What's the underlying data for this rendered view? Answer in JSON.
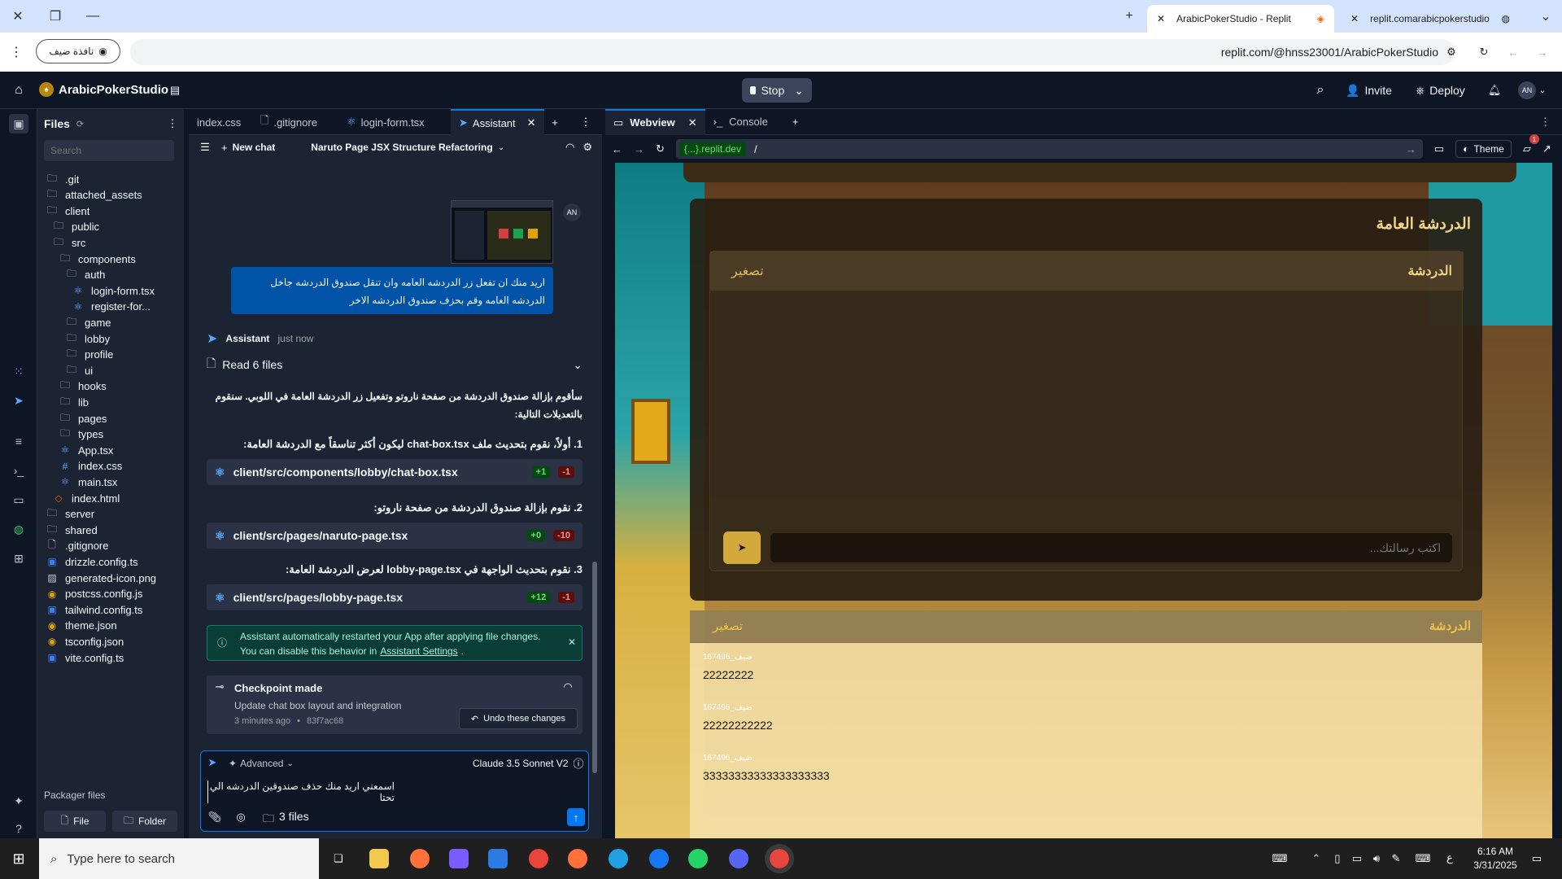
{
  "browser": {
    "tabs": [
      {
        "title": "ArabicPokerStudio - Replit",
        "active": true
      },
      {
        "title": "replit.comarabicpokerstudio",
        "active": false
      }
    ],
    "guest_label": "نافذة ضيف",
    "url": "replit.com/@hnss23001/ArabicPokerStudio"
  },
  "replit": {
    "project_name": "ArabicPokerStudio",
    "stop_label": "Stop",
    "invite_label": "Invite",
    "deploy_label": "Deploy",
    "avatar": "AN"
  },
  "files": {
    "title": "Files",
    "search_placeholder": "Search",
    "tree": [
      {
        "name": ".git",
        "type": "folder",
        "depth": 0
      },
      {
        "name": "attached_assets",
        "type": "folder",
        "depth": 0
      },
      {
        "name": "client",
        "type": "folder",
        "depth": 0
      },
      {
        "name": "public",
        "type": "folder",
        "depth": 1
      },
      {
        "name": "src",
        "type": "folder",
        "depth": 1
      },
      {
        "name": "components",
        "type": "folder",
        "depth": 2
      },
      {
        "name": "auth",
        "type": "folder",
        "depth": 3
      },
      {
        "name": "login-form.tsx",
        "type": "react",
        "depth": 4
      },
      {
        "name": "register-for...",
        "type": "react",
        "depth": 4
      },
      {
        "name": "game",
        "type": "folder",
        "depth": 3
      },
      {
        "name": "lobby",
        "type": "folder",
        "depth": 3
      },
      {
        "name": "profile",
        "type": "folder",
        "depth": 3
      },
      {
        "name": "ui",
        "type": "folder",
        "depth": 3
      },
      {
        "name": "hooks",
        "type": "folder",
        "depth": 2
      },
      {
        "name": "lib",
        "type": "folder",
        "depth": 2
      },
      {
        "name": "pages",
        "type": "folder",
        "depth": 2
      },
      {
        "name": "types",
        "type": "folder",
        "depth": 2
      },
      {
        "name": "App.tsx",
        "type": "react",
        "depth": 2
      },
      {
        "name": "index.css",
        "type": "css",
        "depth": 2
      },
      {
        "name": "main.tsx",
        "type": "react",
        "depth": 2
      },
      {
        "name": "index.html",
        "type": "html",
        "depth": 1
      },
      {
        "name": "server",
        "type": "folder",
        "depth": 0
      },
      {
        "name": "shared",
        "type": "folder",
        "depth": 0
      },
      {
        "name": ".gitignore",
        "type": "file",
        "depth": 0
      },
      {
        "name": "drizzle.config.ts",
        "type": "ts",
        "depth": 0
      },
      {
        "name": "generated-icon.png",
        "type": "image",
        "depth": 0
      },
      {
        "name": "postcss.config.js",
        "type": "js",
        "depth": 0
      },
      {
        "name": "tailwind.config.ts",
        "type": "ts",
        "depth": 0
      },
      {
        "name": "theme.json",
        "type": "json",
        "depth": 0
      },
      {
        "name": "tsconfig.json",
        "type": "json",
        "depth": 0
      },
      {
        "name": "vite.config.ts",
        "type": "ts",
        "depth": 0
      }
    ],
    "packager_label": "Packager files",
    "new_file_label": "File",
    "new_folder_label": "Folder"
  },
  "editor_tabs": [
    {
      "label": "index.css",
      "active": false
    },
    {
      "label": ".gitignore",
      "active": false
    },
    {
      "label": "login-form.tsx",
      "active": false
    },
    {
      "label": "Assistant",
      "active": true
    }
  ],
  "assistant": {
    "new_chat_label": "New chat",
    "chat_title": "Naruto Page JSX Structure Refactoring",
    "user_avatar": "AN",
    "user_message": "اريد منك ان تفعل زر الدردشه العامه وان تنقل صندوق الدردشه جاخل الدردشه العامه وقم بحزف صندوق الدردشه الاخر",
    "sender": "Assistant",
    "time": "just now",
    "read_files": "Read 6 files",
    "intro": "سأقوم بإزالة صندوق الدردشة من صفحة ناروتو وتفعيل زر الدردشة العامة في اللوبي. سنقوم بالتعديلات التالية:",
    "steps": [
      {
        "text": "1. أولاً، نقوم بتحديث ملف chat-box.tsx ليكون أكثر تناسقاً مع الدردشة العامة:",
        "file": "client/src/components/lobby/chat-box.tsx",
        "plus": "+1",
        "minus": "-1"
      },
      {
        "text": "2. نقوم بإزالة صندوق الدردشة من صفحة ناروتو:",
        "file": "client/src/pages/naruto-page.tsx",
        "plus": "+0",
        "minus": "-10"
      },
      {
        "text": "3. نقوم بتحديث الواجهة في lobby-page.tsx لعرض الدردشة العامة:",
        "file": "client/src/pages/lobby-page.tsx",
        "plus": "+12",
        "minus": "-1"
      }
    ],
    "notice_line1": "Assistant automatically restarted your App after applying file changes.",
    "notice_line2": "You can disable this behavior in",
    "notice_link": "Assistant Settings",
    "checkpoint_title": "Checkpoint made",
    "checkpoint_desc": "Update chat box layout and integration",
    "checkpoint_time": "3 minutes ago",
    "checkpoint_hash": "83f7ac68",
    "undo_label": "Undo these changes",
    "advanced_label": "Advanced",
    "model_label": "Claude 3.5 Sonnet V2",
    "input_text": "اسمعني اريد منك حذف صندوقين الدردشه الي تحتا",
    "files_label": "3 files"
  },
  "webview": {
    "tabs": [
      {
        "label": "Webview",
        "active": true
      },
      {
        "label": "Console",
        "active": false
      }
    ],
    "host": "{...}.replit.dev",
    "path": "/",
    "theme_label": "Theme",
    "notif_count": "1"
  },
  "app": {
    "public_chat_title": "الدردشة العامة",
    "chat_label": "الدردشة",
    "minimize_label": "تصغير",
    "input_placeholder": "اكتب رسالتك...",
    "messages": [
      {
        "user": "ضيف_167496",
        "text": "22222222"
      },
      {
        "user": "ضيف_167496",
        "text": "22222222222"
      },
      {
        "user": "ضيف_167496",
        "text": "33333333333333333333"
      }
    ]
  },
  "taskbar": {
    "search_placeholder": "Type here to search",
    "time": "6:16 AM",
    "date": "3/31/2025",
    "lang": "ع"
  }
}
